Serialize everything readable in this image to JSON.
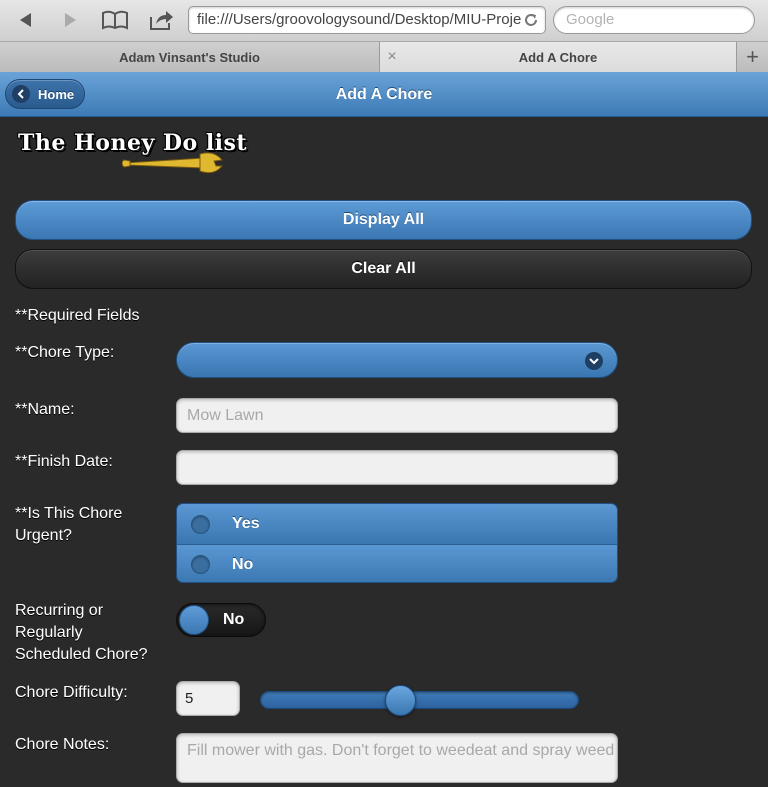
{
  "browser": {
    "url": "file:///Users/groovologysound/Desktop/MIU-Proje",
    "search_placeholder": "Google",
    "tabs": [
      {
        "label": "Adam Vinsant's Studio"
      },
      {
        "label": "Add A Chore"
      }
    ],
    "close_glyph": "×",
    "new_tab_glyph": "+"
  },
  "header": {
    "home_label": "Home",
    "title": "Add A Chore"
  },
  "logo": {
    "text": "The Honey Do list"
  },
  "buttons": {
    "display_all": "Display All",
    "clear_all": "Clear All"
  },
  "form": {
    "required_note": "**Required Fields",
    "chore_type": {
      "label": "**Chore Type:",
      "value": ""
    },
    "name": {
      "label": "**Name:",
      "placeholder": "Mow Lawn"
    },
    "finish_date": {
      "label": "**Finish Date:",
      "value": ""
    },
    "urgent": {
      "label_line1": "**Is This Chore",
      "label_line2": "Urgent?",
      "options": [
        "Yes",
        "No"
      ]
    },
    "recurring": {
      "label_line1": "Recurring or",
      "label_line2": "Regularly",
      "label_line3": "Scheduled Chore?",
      "toggle_state": "No"
    },
    "difficulty": {
      "label": "Chore Difficulty:",
      "value": "5",
      "slider_fraction": 0.44
    },
    "notes": {
      "label": "Chore Notes:",
      "placeholder": "Fill mower with gas. Don't forget to weedeat and spray weed"
    }
  },
  "colors": {
    "accent_blue": "#4a88c4",
    "background": "#2a2a2a"
  }
}
